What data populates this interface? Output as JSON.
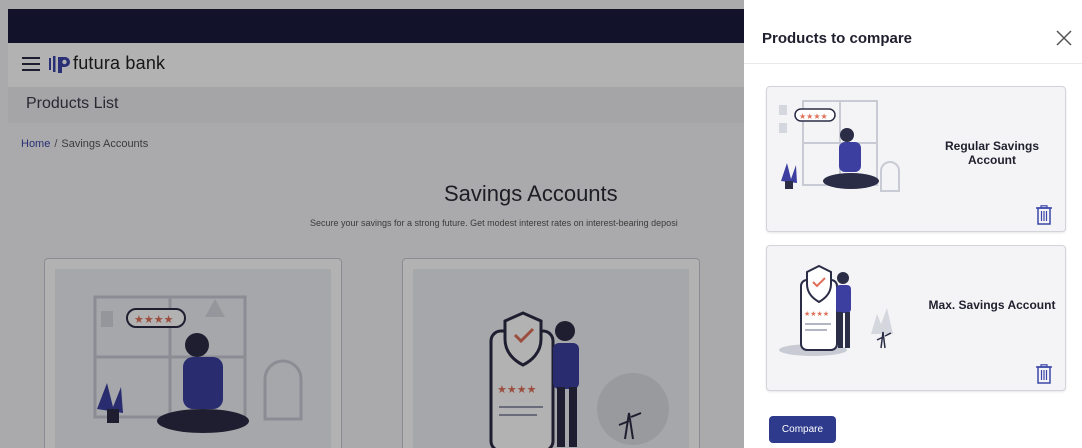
{
  "brand": {
    "name": "futura bank"
  },
  "header": {
    "page_title": "Products List"
  },
  "breadcrumb": {
    "home": "Home",
    "separator": "/",
    "current": "Savings Accounts"
  },
  "main": {
    "title": "Savings Accounts",
    "subtitle": "Secure your savings for a strong future. Get modest interest rates on interest-bearing deposi",
    "cards": [
      {
        "rating_stars": "★★★★"
      },
      {
        "rating_stars": "★★★★"
      }
    ]
  },
  "compare_panel": {
    "title": "Products to compare",
    "products": [
      {
        "name": "Regular Savings Account",
        "rating_stars": "★★★★"
      },
      {
        "name": "Max. Savings Account",
        "rating_stars": "★★★★"
      }
    ],
    "compare_label": "Compare"
  },
  "colors": {
    "topbar": "#1b1c3d",
    "accent": "#2e3a8c",
    "illustration_blue": "#3c3fa0",
    "illustration_orange": "#e0705a"
  },
  "icons": [
    "menu-icon",
    "futura-logo-icon",
    "close-icon",
    "trash-icon"
  ]
}
